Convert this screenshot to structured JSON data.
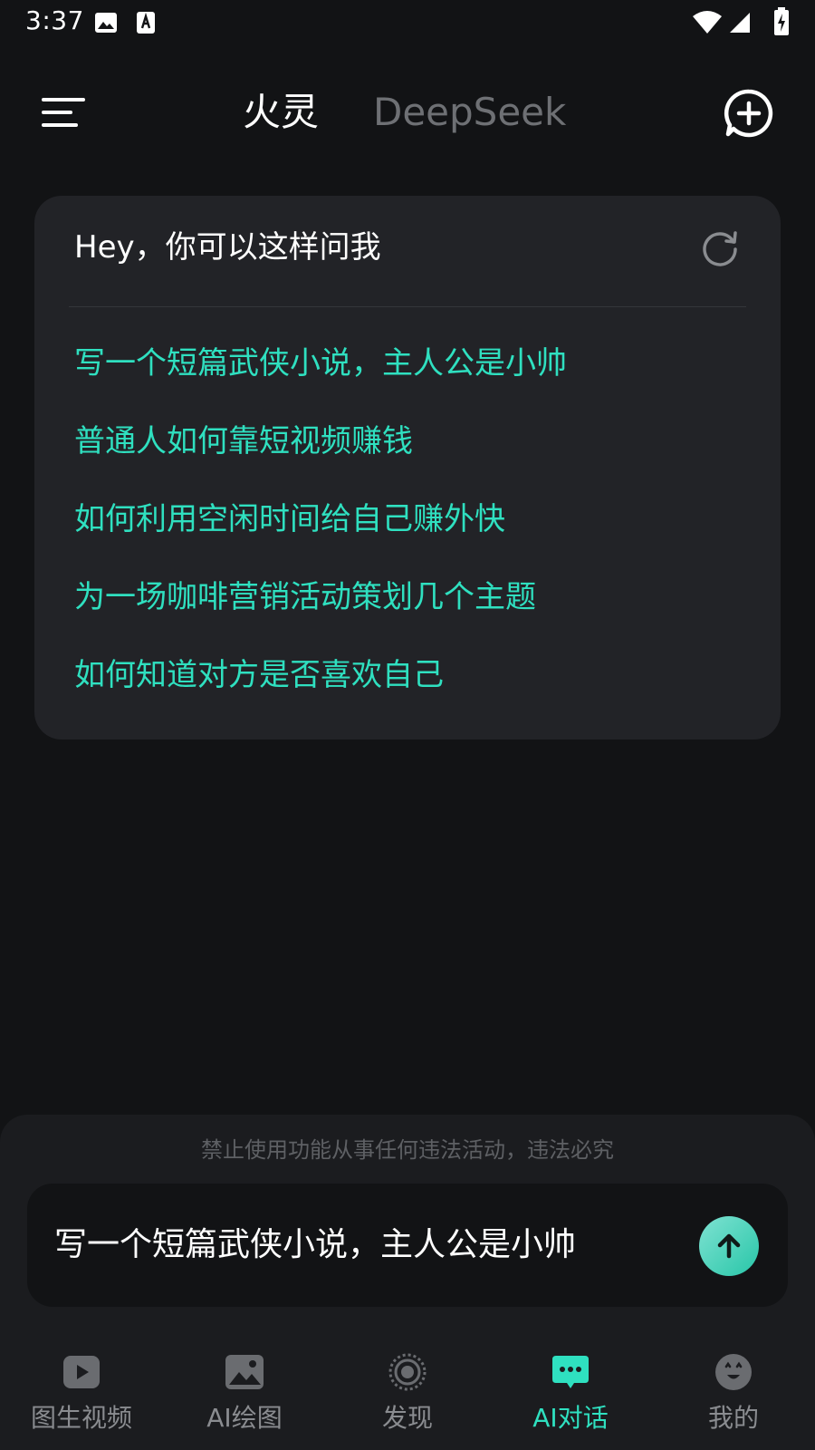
{
  "status_bar": {
    "time": "3:37",
    "icons": [
      "image-icon",
      "a-notification-icon",
      "wifi-icon",
      "signal-icon",
      "battery-charging-icon"
    ]
  },
  "header": {
    "tabs": [
      {
        "label": "火灵",
        "active": true
      },
      {
        "label": "DeepSeek",
        "active": false
      }
    ],
    "menu_icon": "menu-icon",
    "new_chat_icon": "add-chat-icon"
  },
  "suggestions": {
    "title": "Hey，你可以这样问我",
    "refresh_icon": "refresh-icon",
    "items": [
      "写一个短篇武侠小说，主人公是小帅",
      "普通人如何靠短视频赚钱",
      "如何利用空闲时间给自己赚外快",
      "为一场咖啡营销活动策划几个主题",
      "如何知道对方是否喜欢自己"
    ]
  },
  "composer": {
    "disclaimer": "禁止使用功能从事任何违法活动，违法必究",
    "value": "写一个短篇武侠小说，主人公是小帅",
    "send_icon": "arrow-up-icon"
  },
  "bottom_nav": {
    "items": [
      {
        "label": "图生视频",
        "icon": "video-play-icon",
        "active": false
      },
      {
        "label": "AI绘图",
        "icon": "image-icon",
        "active": false
      },
      {
        "label": "发现",
        "icon": "discover-icon",
        "active": false
      },
      {
        "label": "AI对话",
        "icon": "chat-bubble-icon",
        "active": true
      },
      {
        "label": "我的",
        "icon": "profile-face-icon",
        "active": false
      }
    ]
  },
  "colors": {
    "background": "#121315",
    "card": "#222327",
    "accent": "#2fe0c0",
    "muted_text": "#6e7074"
  }
}
